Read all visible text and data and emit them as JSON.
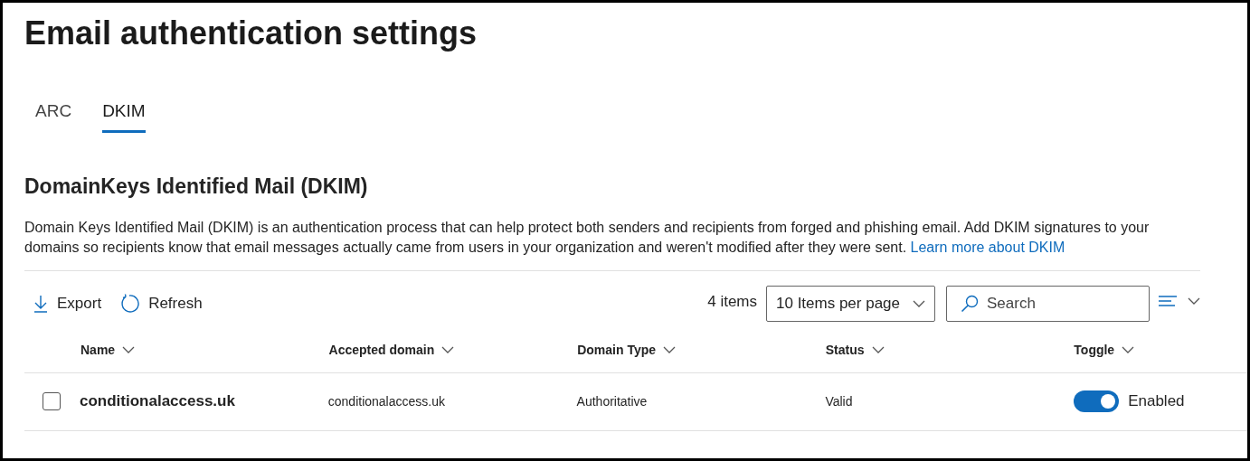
{
  "page_title": "Email authentication settings",
  "tabs": [
    {
      "label": "ARC",
      "selected": false
    },
    {
      "label": "DKIM",
      "selected": true
    }
  ],
  "section": {
    "heading": "DomainKeys Identified Mail (DKIM)",
    "description": "Domain Keys Identified Mail (DKIM) is an authentication process that can help protect both senders and recipients from forged and phishing email. Add DKIM signatures to your domains so recipients know that email messages actually came from users in your organization and weren't modified after they were sent.",
    "link": "Learn more about DKIM"
  },
  "toolbar": {
    "export": "Export",
    "refresh": "Refresh",
    "item_count": "4 items",
    "page_size": "10 Items per page",
    "search": {
      "placeholder": "Search"
    }
  },
  "table": {
    "columns": [
      "Name",
      "Accepted domain",
      "Domain Type",
      "Status",
      "Toggle"
    ],
    "rows": [
      {
        "selected": false,
        "name": "conditionalaccess.uk",
        "accepted_domain": "conditionalaccess.uk",
        "domain_type": "Authoritative",
        "status": "Valid",
        "toggle": {
          "on": true,
          "label": "Enabled"
        }
      }
    ]
  }
}
